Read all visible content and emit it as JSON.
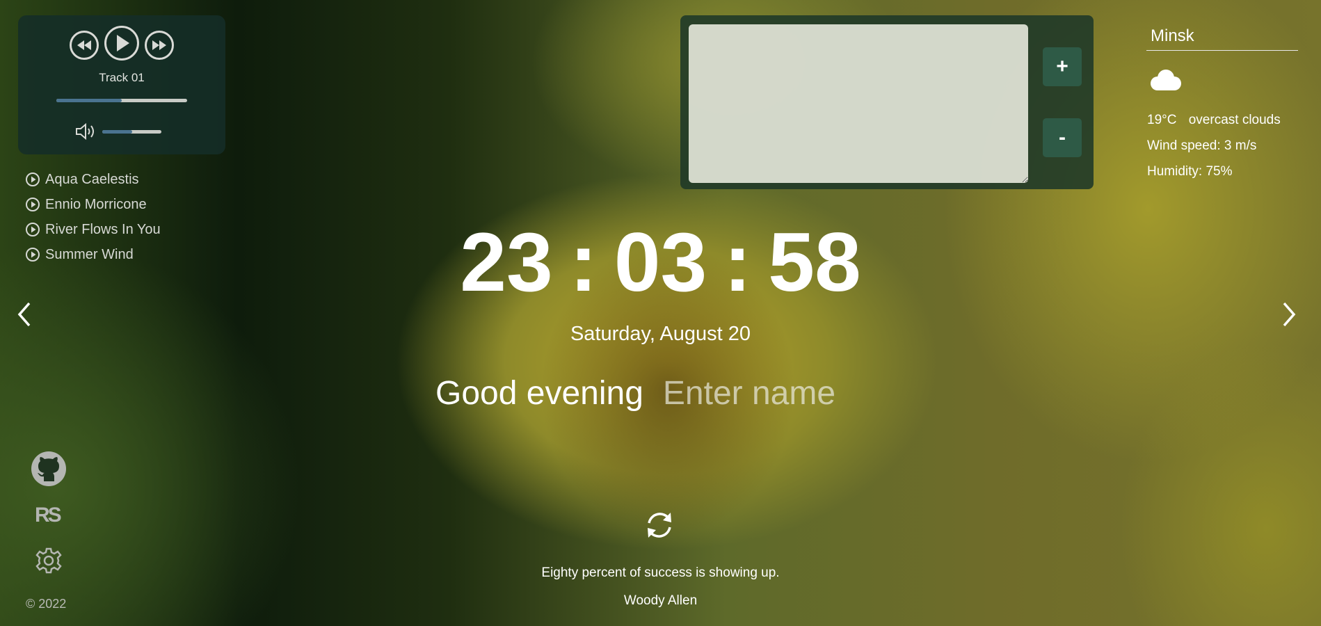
{
  "player": {
    "track": "Track 01",
    "progress": 0.5,
    "volume": 0.5,
    "controls": {
      "prev": "rewind-icon",
      "play": "play-icon",
      "next": "fast-forward-icon"
    },
    "playlist": [
      "Aqua Caelestis",
      "Ennio Morricone",
      "River Flows In You",
      "Summer Wind"
    ]
  },
  "quotes_widget": {
    "add_label": "+",
    "remove_label": "-"
  },
  "weather": {
    "city": "Minsk",
    "icon": "cloud-icon",
    "temperature": "19°C",
    "description": "overcast clouds",
    "wind": "Wind speed: 3 m/s",
    "humidity": "Humidity: 75%"
  },
  "clock": {
    "hours": "23",
    "minutes": "03",
    "seconds": "58",
    "separator": ":"
  },
  "date": "Saturday, August 20",
  "greeting": {
    "text": "Good evening",
    "name_placeholder": "Enter name"
  },
  "quote": {
    "text": "Eighty percent of success is showing up.",
    "author": "Woody Allen"
  },
  "footer": {
    "rs_logo": "RS",
    "copyright": "© 2022"
  },
  "colors": {
    "panel": "#1e3828",
    "accent": "#4a7390",
    "button": "#2e5a46"
  }
}
